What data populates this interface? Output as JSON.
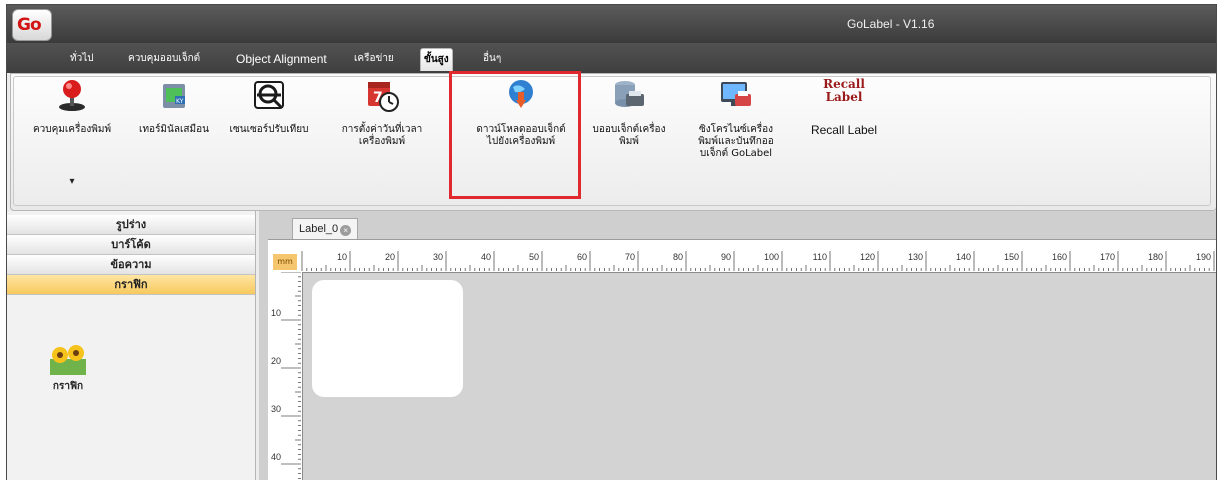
{
  "window": {
    "title": "GoLabel - V1.16",
    "logo_text": "Go"
  },
  "tabs": [
    {
      "label": "ทั่วไป",
      "active": false
    },
    {
      "label": "ควบคุมออบเจ็กต์",
      "active": false
    },
    {
      "label": "Object Alignment",
      "active": false
    },
    {
      "label": "เครือข่าย",
      "active": false
    },
    {
      "label": "ขั้นสูง",
      "active": true
    },
    {
      "label": "อื่นๆ",
      "active": false
    }
  ],
  "ribbon": {
    "buttons": [
      {
        "label": "ควบคุมเครื่องพิมพ์",
        "icon": "joystick-icon"
      },
      {
        "label": "เทอร์มินัลเสมือน",
        "icon": "terminal-icon"
      },
      {
        "label": "เซนเซอร์ปรับเทียบ",
        "icon": "sensor-icon"
      },
      {
        "label": "การตั้งค่าวันที่เวลา\nเครื่องพิมพ์",
        "icon": "calendar-clock-icon"
      },
      {
        "label": "ดาวน์โหลดออบเจ็กต์\nไปยังเครื่องพิมพ์",
        "icon": "download-globe-icon"
      },
      {
        "label": "บออบเจ็กต์เครื่อง\nพิมพ์",
        "icon": "printer-database-icon"
      },
      {
        "label": "ซิงโครไนซ์เครื่อง\nพิมพ์และบันทึกออ\nบเจ็กต์ GoLabel",
        "icon": "sync-monitor-icon"
      },
      {
        "label": "Recall Label",
        "icon": "recall-label-icon",
        "icon_text_top": "Recall",
        "icon_text_bottom": "Label"
      }
    ],
    "dropdown_arrow": "▾"
  },
  "left_panel": {
    "categories": [
      {
        "label": "รูปร่าง",
        "active": false
      },
      {
        "label": "บาร์โค้ด",
        "active": false
      },
      {
        "label": "ข้อความ",
        "active": false
      },
      {
        "label": "กราฟิก",
        "active": true
      }
    ],
    "palette_item_label": "กราฟิก"
  },
  "document": {
    "tab_label": "Label_0",
    "ruler_unit": "mm",
    "h_ticks": [
      "10",
      "20",
      "30",
      "40",
      "50",
      "60",
      "70",
      "80",
      "90",
      "100",
      "110",
      "120",
      "130",
      "140",
      "150",
      "160",
      "170",
      "180",
      "190"
    ],
    "v_ticks": [
      "10",
      "20",
      "30",
      "40"
    ]
  },
  "colors": {
    "highlight": "#e0282f",
    "active_category": "#f7c95e",
    "titlebar": "#4a4a4a"
  }
}
